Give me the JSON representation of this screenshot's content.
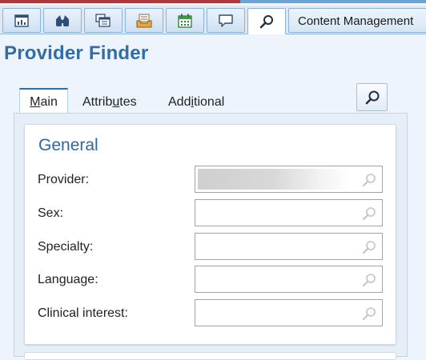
{
  "toolbar": {
    "buttons": [
      {
        "icon": "report-icon"
      },
      {
        "icon": "binoculars-icon"
      },
      {
        "icon": "windows-icon"
      },
      {
        "icon": "inbox-icon"
      },
      {
        "icon": "calendar-icon"
      },
      {
        "icon": "speech-bubble-icon"
      },
      {
        "icon": "search-icon",
        "active": true
      }
    ],
    "content_label": "Content Management"
  },
  "page": {
    "title": "Provider Finder"
  },
  "tabs": [
    {
      "label": "Main",
      "mnemonic": "M",
      "active": true
    },
    {
      "label": "Attributes",
      "mnemonic": "u"
    },
    {
      "label": "Additional",
      "mnemonic": "i"
    }
  ],
  "group": {
    "title": "General",
    "fields": [
      {
        "label": "Provider:",
        "value": "",
        "redacted": true
      },
      {
        "label": "Sex:",
        "value": ""
      },
      {
        "label": "Specialty:",
        "value": ""
      },
      {
        "label": "Language:",
        "value": ""
      },
      {
        "label": "Clinical interest:",
        "value": ""
      }
    ]
  },
  "colors": {
    "accent": "#2f6ea8",
    "toolbar_bg": "#dde9f6",
    "page_bg": "#eef4fb"
  }
}
